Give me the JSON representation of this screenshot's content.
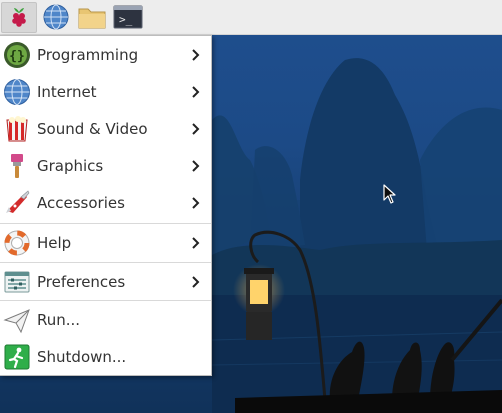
{
  "desktop": {
    "colors": {
      "sky": "#1f4f8f",
      "water": "#0b2444",
      "lantern": "#ffd36b"
    }
  },
  "taskbar": {
    "buttons": [
      {
        "icon": "raspberry-pi-logo",
        "active": true
      },
      {
        "icon": "globe-icon"
      },
      {
        "icon": "folder-icon"
      },
      {
        "icon": "terminal-icon",
        "text": ">_"
      }
    ]
  },
  "menu": {
    "items": [
      {
        "label": "Programming",
        "icon": "programming-icon",
        "submenu": true
      },
      {
        "label": "Internet",
        "icon": "internet-globe-icon",
        "submenu": true
      },
      {
        "label": "Sound & Video",
        "icon": "sound-video-icon",
        "submenu": true
      },
      {
        "label": "Graphics",
        "icon": "graphics-brush-icon",
        "submenu": true
      },
      {
        "label": "Accessories",
        "icon": "accessories-knife-icon",
        "submenu": true
      },
      {
        "label": "Help",
        "icon": "help-lifebuoy-icon",
        "submenu": true
      },
      {
        "label": "Preferences",
        "icon": "preferences-icon",
        "submenu": true
      },
      {
        "label": "Run...",
        "icon": "run-paper-plane-icon",
        "submenu": false
      },
      {
        "label": "Shutdown...",
        "icon": "shutdown-exit-icon",
        "submenu": false
      }
    ]
  }
}
